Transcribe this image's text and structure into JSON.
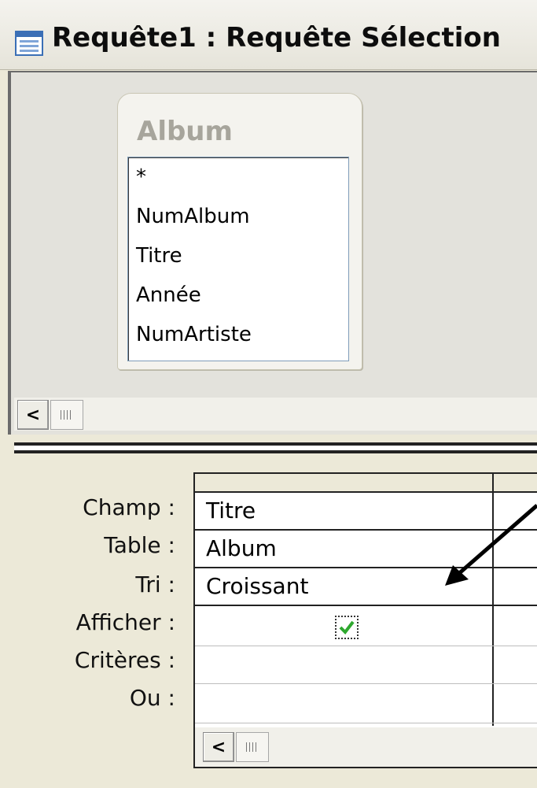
{
  "window": {
    "title": "Requête1 : Requête Sélection",
    "icon": "query-icon"
  },
  "field_list": {
    "table_name": "Album",
    "fields": [
      "*",
      "NumAlbum",
      "Titre",
      "Année",
      "NumArtiste"
    ]
  },
  "scrollbars": {
    "left_arrow": "<"
  },
  "grid": {
    "row_labels": [
      "Champ :",
      "Table :",
      "Tri :",
      "Afficher :",
      "Critères :",
      "Ou :"
    ],
    "column1": {
      "champ": "Titre",
      "table": "Album",
      "tri": "Croissant",
      "afficher": true,
      "criteres": "",
      "ou": ""
    }
  },
  "colors": {
    "accent_title_bar": "#f4f3ee",
    "checkbox_check": "#2ea82e"
  }
}
